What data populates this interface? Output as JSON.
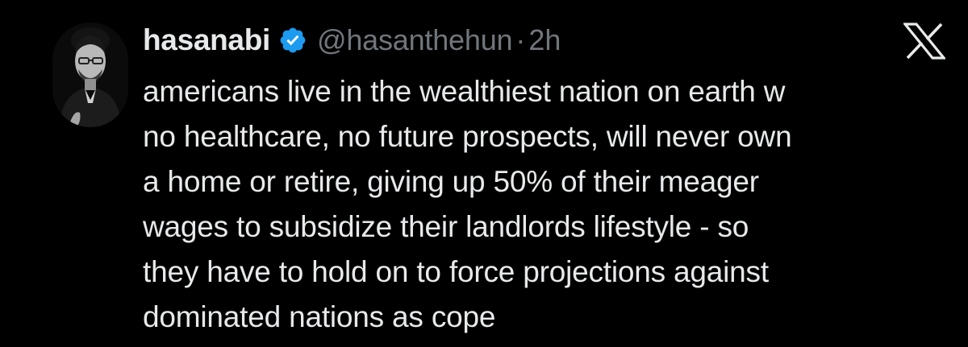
{
  "author": {
    "display_name": "hasanabi",
    "handle": "@hasanthehun",
    "separator": "·",
    "time": "2h",
    "verified_icon": "verified-badge-icon",
    "avatar": "profile-photo"
  },
  "brand_icon": "x-logo-icon",
  "colors": {
    "background": "#000000",
    "text": "#e7e9ea",
    "secondary_text": "#71767b",
    "verified": "#1d9bf0"
  },
  "tweet": {
    "lines": [
      "americans live in the wealthiest nation on earth w",
      "no healthcare, no future prospects, will never own",
      "a home or retire, giving up 50% of their meager",
      "wages to subsidize their landlords lifestyle - so",
      "they have to hold on to force projections against",
      "dominated nations as cope"
    ]
  }
}
